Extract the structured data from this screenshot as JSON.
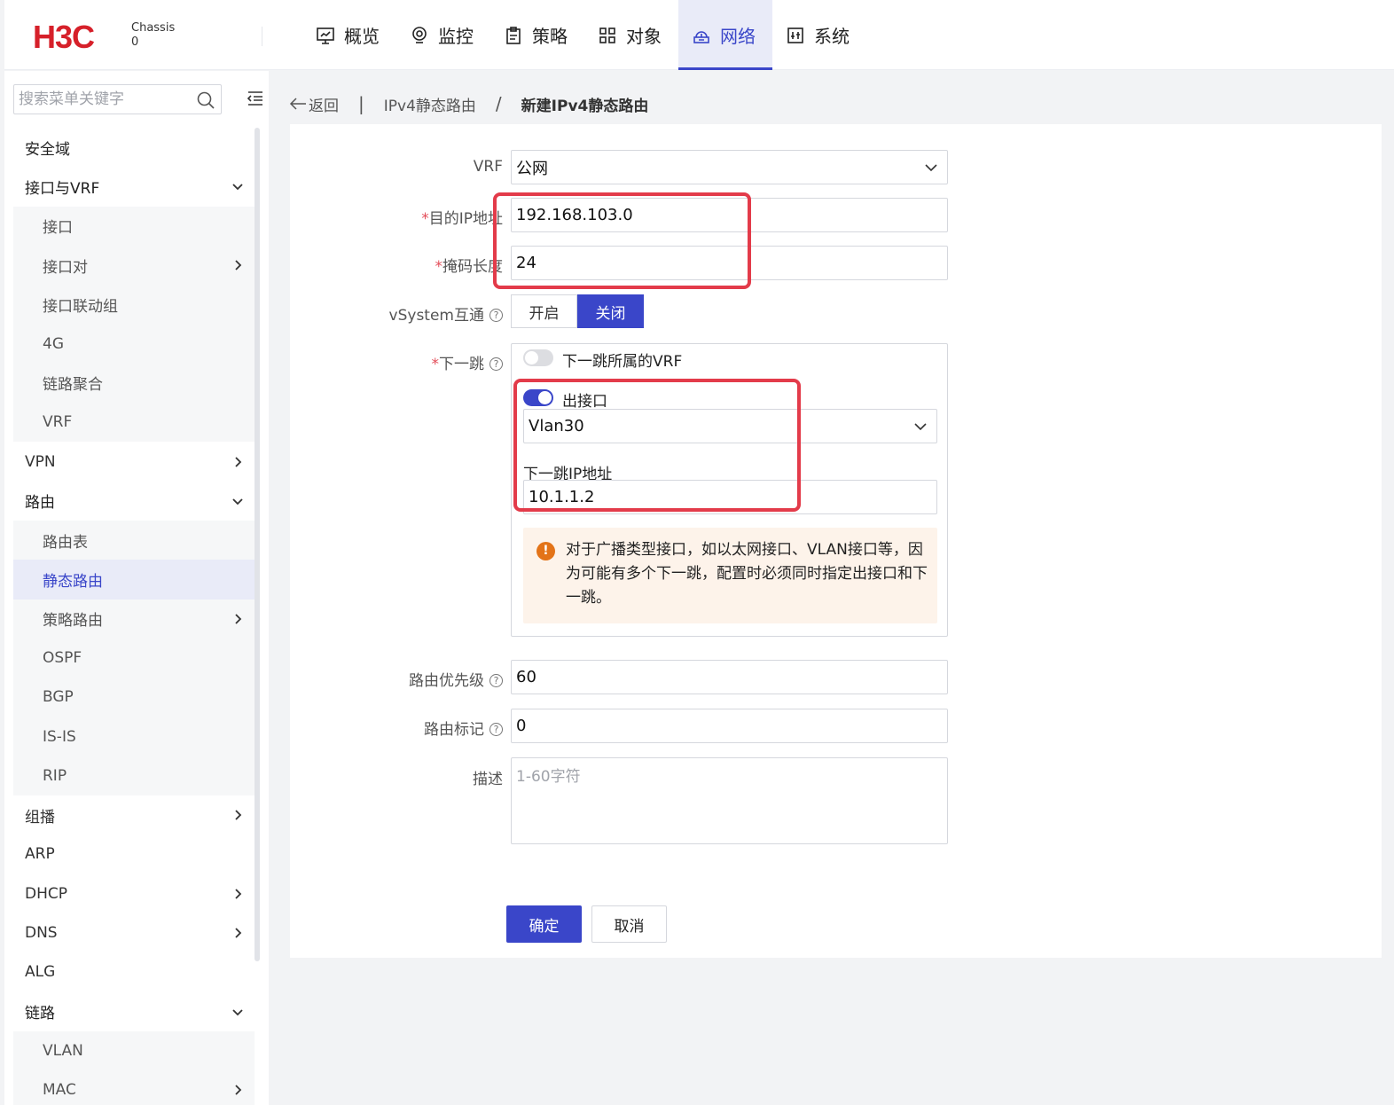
{
  "header": {
    "logo": "H3C",
    "chassis_label": "Chassis",
    "chassis_value": "0",
    "nav": [
      {
        "label": "概览",
        "icon": "monitor-chart-icon"
      },
      {
        "label": "监控",
        "icon": "location-pin-icon"
      },
      {
        "label": "策略",
        "icon": "clipboard-icon"
      },
      {
        "label": "对象",
        "icon": "grid-icon"
      },
      {
        "label": "网络",
        "icon": "network-cloud-icon"
      },
      {
        "label": "系统",
        "icon": "settings-panel-icon"
      }
    ],
    "active_nav": "网络"
  },
  "sidebar": {
    "search_placeholder": "搜索菜单关键字",
    "items": [
      {
        "label": "安全域"
      },
      {
        "label": "接口与VRF"
      },
      {
        "label": "接口"
      },
      {
        "label": "接口对"
      },
      {
        "label": "接口联动组"
      },
      {
        "label": "4G"
      },
      {
        "label": "链路聚合"
      },
      {
        "label": "VRF"
      },
      {
        "label": "VPN"
      },
      {
        "label": "路由"
      },
      {
        "label": "路由表"
      },
      {
        "label": "静态路由"
      },
      {
        "label": "策略路由"
      },
      {
        "label": "OSPF"
      },
      {
        "label": "BGP"
      },
      {
        "label": "IS-IS"
      },
      {
        "label": "RIP"
      },
      {
        "label": "组播"
      },
      {
        "label": "ARP"
      },
      {
        "label": "DHCP"
      },
      {
        "label": "DNS"
      },
      {
        "label": "ALG"
      },
      {
        "label": "链路"
      },
      {
        "label": "VLAN"
      },
      {
        "label": "MAC"
      }
    ]
  },
  "breadcrumb": {
    "back": "返回",
    "parent": "IPv4静态路由",
    "current": "新建IPv4静态路由"
  },
  "form": {
    "vrf_label": "VRF",
    "vrf_value": "公网",
    "dest_ip_label": "目的IP地址",
    "dest_ip_value": "192.168.103.0",
    "mask_label": "掩码长度",
    "mask_value": "24",
    "vsystem_label": "vSystem互通",
    "vsystem_on": "开启",
    "vsystem_off": "关闭",
    "vsystem_selected": "关闭",
    "nexthop_label": "下一跳",
    "nexthop_vrf_switch": "下一跳所属的VRF",
    "out_iface_switch": "出接口",
    "out_iface_value": "Vlan30",
    "nexthop_ip_label": "下一跳IP地址",
    "nexthop_ip_value": "10.1.1.2",
    "warning": "对于广播类型接口，如以太网接口、VLAN接口等，因为可能有多个下一跳，配置时必须同时指定出接口和下一跳。",
    "priority_label": "路由优先级",
    "priority_value": "60",
    "tag_label": "路由标记",
    "tag_value": "0",
    "desc_label": "描述",
    "desc_placeholder": "1-60字符",
    "required_mark": "*",
    "help_mark": "?",
    "ok": "确定",
    "cancel": "取消"
  },
  "colors": {
    "brand_red": "#d6202a",
    "accent_blue": "#3a46c9",
    "highlight_red": "#e33b4a",
    "warning_orange": "#e37318"
  }
}
